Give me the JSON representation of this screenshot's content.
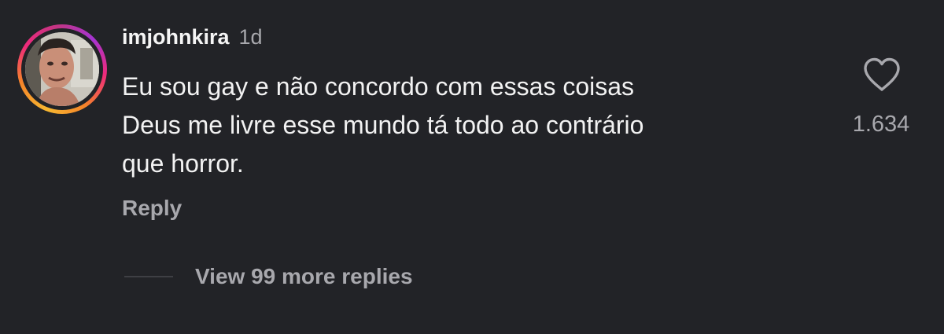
{
  "comment": {
    "username": "imjohnkira",
    "time_ago": "1d",
    "lines": [
      "Eu sou gay e não concordo com essas coisas",
      "Deus me livre esse mundo tá todo ao contrário",
      "que horror."
    ],
    "reply_label": "Reply",
    "like_count": "1.634",
    "view_replies_label": "View 99 more replies",
    "like_icon": "heart-outline-icon",
    "avatar_has_story_ring": true
  },
  "colors": {
    "background": "#222327",
    "primary_text": "#f2f2f2",
    "secondary_text": "#a8a8ad",
    "story_ring": [
      "#f7b731",
      "#f58529",
      "#ee2a7b",
      "#c13584",
      "#a534d2"
    ]
  }
}
